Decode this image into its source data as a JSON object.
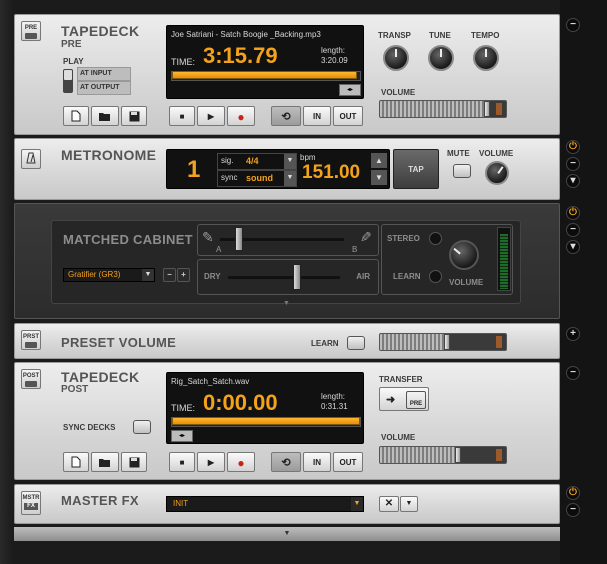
{
  "tapedeck_pre": {
    "tag": "PRE",
    "title": "TAPEDECK",
    "subtitle": "PRE",
    "play_label": "PLAY",
    "play_options": [
      "AT INPUT",
      "AT OUTPUT"
    ],
    "filename": "Joe Satriani - Satch Boogie _Backing.mp3",
    "time_label": "TIME:",
    "time": "3:15.79",
    "length_label": "length:",
    "length": "3:20.09",
    "progress": 0.985,
    "transport": [
      "IN",
      "OUT"
    ],
    "knob_labels": [
      "TRANSP",
      "TUNE",
      "TEMPO"
    ],
    "volume_label": "VOLUME",
    "volume": 0.9
  },
  "metronome": {
    "title": "METRONOME",
    "beat": "1",
    "sig_label": "sig.",
    "sig_value": "4/4",
    "sync_label": "sync",
    "sync_value": "sound",
    "bpm_label": "bpm",
    "bpm": "151.00",
    "tap_label": "TAP",
    "mute_label": "MUTE",
    "volume_label": "VOLUME"
  },
  "matched_cabinet": {
    "title": "MATCHED CABINET",
    "ab_a": "A",
    "ab_b": "B",
    "ab_pos": 0.12,
    "stereo_label": "STEREO",
    "learn_label": "LEARN",
    "preset": "Gratifier (GR3)",
    "dry_label": "DRY",
    "air_label": "AIR",
    "dry_air_pos": 0.58,
    "volume_label": "VOLUME",
    "meter_level": 0.95
  },
  "preset_volume": {
    "tag": "PRST",
    "title": "PRESET VOLUME",
    "learn_label": "LEARN",
    "level": 0.55
  },
  "tapedeck_post": {
    "tag": "POST",
    "title": "TAPEDECK",
    "subtitle": "POST",
    "sync_label": "SYNC DECKS",
    "filename": "Rig_Satch_Satch.wav",
    "time_label": "TIME:",
    "time": "0:00.00",
    "length_label": "length:",
    "length": "0:31.31",
    "transfer_label": "TRANSFER",
    "transfer_tag": "PRE",
    "transport": [
      "IN",
      "OUT"
    ],
    "volume_label": "VOLUME",
    "volume": 0.65
  },
  "master_fx": {
    "tag": "MSTR",
    "tag2": "FX",
    "title": "MASTER FX",
    "selection": "INIT"
  },
  "colors": {
    "accent": "#f3a21c",
    "lcd": "#111111",
    "panel": "#dcdcdc"
  }
}
